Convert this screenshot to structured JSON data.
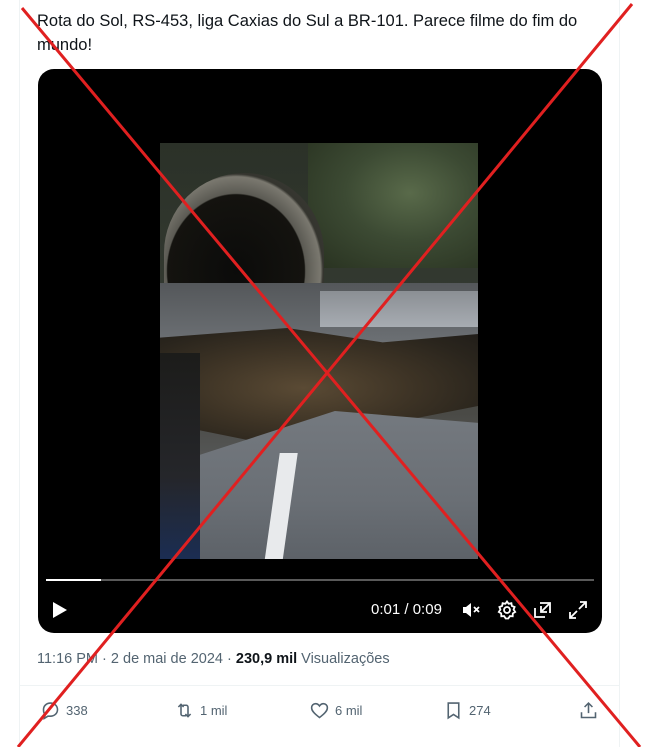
{
  "tweet": {
    "text": "Rota do Sol, RS-453, liga Caxias do Sul a BR-101. Parece filme do fim do mundo!"
  },
  "video": {
    "current_time": "0:01",
    "separator": "/",
    "duration": "0:09",
    "progress_fraction": 0.1,
    "icons": {
      "play": "play-icon",
      "mute": "volume-muted-icon",
      "settings": "gear-icon",
      "pip": "picture-in-picture-icon",
      "fullscreen": "fullscreen-icon"
    }
  },
  "meta": {
    "time": "11:16 PM",
    "dot1": "·",
    "date": "2 de mai de 2024",
    "dot2": "·",
    "views_count": "230,9 mil",
    "views_label": "Visualizações"
  },
  "actions": {
    "reply_count": "338",
    "repost_count": "1 mil",
    "like_count": "6 mil",
    "bookmark_count": "274"
  },
  "colors": {
    "text": "#0f1419",
    "secondary": "#536471",
    "overlay_x": "#e02020"
  }
}
